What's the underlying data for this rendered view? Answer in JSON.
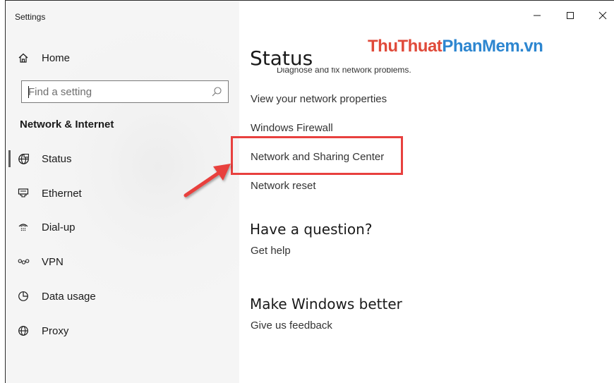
{
  "window": {
    "title": "Settings",
    "controls": {
      "minimize": "–",
      "maximize": "☐",
      "close": "✕"
    }
  },
  "sidebar": {
    "home": {
      "label": "Home",
      "icon": "home-icon"
    },
    "search": {
      "placeholder": "Find a setting",
      "icon": "search-icon"
    },
    "section_title": "Network & Internet",
    "items": [
      {
        "label": "Status",
        "icon": "globe-status-icon",
        "active": true
      },
      {
        "label": "Ethernet",
        "icon": "ethernet-icon",
        "active": false
      },
      {
        "label": "Dial-up",
        "icon": "dial-up-icon",
        "active": false
      },
      {
        "label": "VPN",
        "icon": "vpn-icon",
        "active": false
      },
      {
        "label": "Data usage",
        "icon": "data-usage-icon",
        "active": false
      },
      {
        "label": "Proxy",
        "icon": "globe-icon",
        "active": false
      }
    ]
  },
  "main": {
    "title": "Status",
    "truncated_text": "Diagnose and fix network problems.",
    "links": [
      "View your network properties",
      "Windows Firewall",
      "Network and Sharing Center",
      "Network reset"
    ],
    "question": {
      "heading": "Have a question?",
      "link": "Get help"
    },
    "better": {
      "heading": "Make Windows better",
      "link": "Give us feedback"
    }
  },
  "watermark": {
    "part1": "ThuThuat",
    "part2": "PhanMem.vn"
  },
  "annotation": {
    "color": "#e8403e",
    "target": "Network and Sharing Center"
  }
}
